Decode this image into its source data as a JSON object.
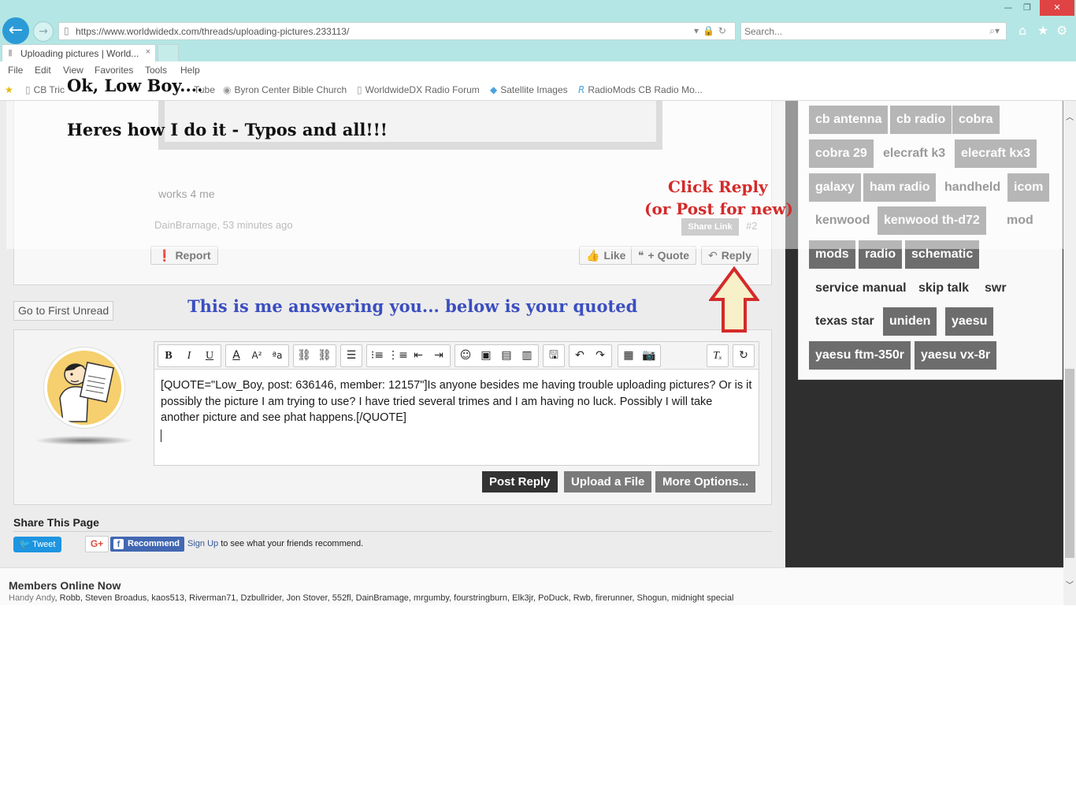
{
  "browser": {
    "url": "https://www.worldwidedx.com/threads/uploading-pictures.233113/",
    "search_placeholder": "Search...",
    "tab_title": "Uploading pictures | World...",
    "tab_close": "×",
    "menu": [
      "File",
      "Edit",
      "View",
      "Favorites",
      "Tools",
      "Help"
    ],
    "favorites": [
      "CB Tric",
      "Tube",
      "Byron Center Bible Church",
      "WorldwideDX Radio Forum",
      "Satellite Images",
      "RadioMods CB Radio Mo..."
    ],
    "window_buttons": {
      "minimize": "—",
      "restore": "❐",
      "close": "✕"
    }
  },
  "post": {
    "text": "works 4 me",
    "meta": "DainBramage, 53 minutes ago",
    "share_link": "Share Link",
    "number": "#2",
    "report": "Report",
    "like": "Like",
    "quote": "+ Quote",
    "reply": "Reply"
  },
  "go_first_unread": "Go to First Unread",
  "editor": {
    "content": "[QUOTE=\"Low_Boy, post: 636146, member: 12157\"]Is anyone besides me having trouble uploading pictures? Or is it possibly the picture I am trying to use? I have tried several trimes and I am having no luck. Possibly I will take another picture and see phat happens.[/QUOTE]",
    "post_reply": "Post Reply",
    "upload_file": "Upload a File",
    "more_options": "More Options...",
    "toolbar": {
      "bold": "B",
      "italic": "I",
      "underline": "U"
    }
  },
  "share": {
    "title": "Share This Page",
    "tweet": "Tweet",
    "gplus": "G+",
    "recommend": "Recommend",
    "signup": "Sign Up",
    "signup_rest": " to see what your friends recommend."
  },
  "members": {
    "title": "Members Online Now",
    "first": "Handy Andy",
    "list": ", Robb, Steven Broadus, kaos513, Riverman71, Dzbullrider, Jon Stover, 552fl, DainBramage, mrgumby, fourstringburn, Elk3jr, PoDuck, Rwb, firerunner, Shogun, midnight special"
  },
  "tags": [
    "cb antenna",
    "cb radio",
    "cobra",
    "cobra 29",
    "elecraft k3",
    "elecraft kx3",
    "galaxy",
    "ham radio",
    "handheld",
    "icom",
    "kenwood",
    "kenwood th-d72",
    "mod",
    "mods",
    "radio",
    "schematic",
    "service manual",
    "skip talk",
    "swr",
    "texas star",
    "uniden",
    "yaesu",
    "yaesu ftm-350r",
    "yaesu vx-8r"
  ],
  "annotations": {
    "greeting": "Ok, Low Boy....",
    "howto": "Heres how I do it - Typos and all!!!",
    "click_reply": "Click Reply",
    "post_new": "(or Post for new)",
    "answering": "This is me answering you... below is your quoted"
  },
  "colors": {
    "chrome": "#b3e6e4",
    "tag_dark": "#6d6d6d",
    "annotation_red": "#d42a2a",
    "annotation_blue": "#3b4ec0",
    "post_reply_button": "#333333",
    "secondary_button": "#7a7a7a",
    "tweet": "#1d95e0",
    "facebook": "#4267b2"
  }
}
